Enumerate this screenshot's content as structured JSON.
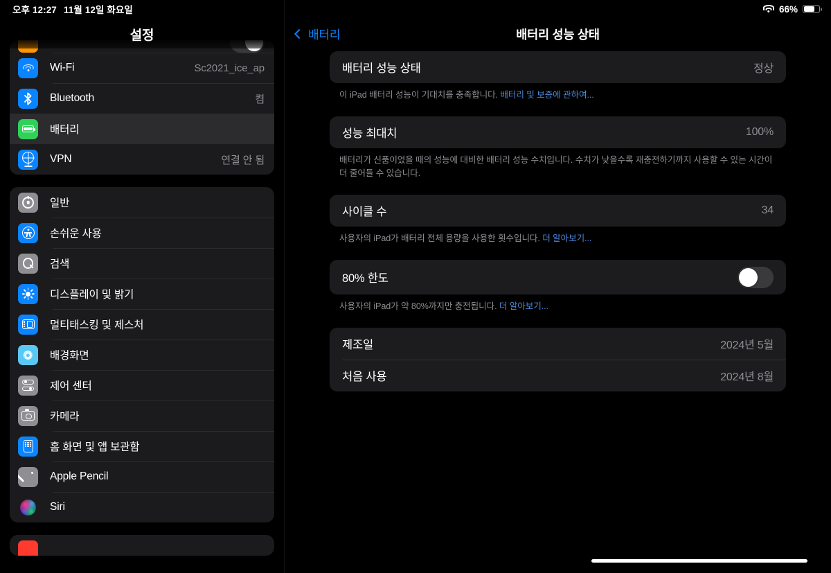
{
  "status_bar": {
    "time": "오후 12:27",
    "date": "11월 12일 화요일",
    "battery_percent": "66%",
    "wifi_icon": "wifi-icon",
    "battery_icon": "battery-icon"
  },
  "sidebar": {
    "title": "설정",
    "groups": [
      {
        "name": "connectivity",
        "items": [
          {
            "label": "",
            "value": "",
            "icon": "airplane-mode-icon",
            "partial": true,
            "toggle": true
          },
          {
            "label": "Wi-Fi",
            "value": "Sc2021_ice_ap",
            "icon": "wifi-icon"
          },
          {
            "label": "Bluetooth",
            "value": "켬",
            "icon": "bluetooth-icon"
          },
          {
            "label": "배터리",
            "value": "",
            "icon": "battery-icon",
            "selected": true
          },
          {
            "label": "VPN",
            "value": "연결 안 됨",
            "icon": "vpn-globe-icon"
          }
        ]
      },
      {
        "name": "system",
        "items": [
          {
            "label": "일반",
            "value": "",
            "icon": "gear-icon"
          },
          {
            "label": "손쉬운 사용",
            "value": "",
            "icon": "accessibility-icon"
          },
          {
            "label": "검색",
            "value": "",
            "icon": "search-icon"
          },
          {
            "label": "디스플레이 및 밝기",
            "value": "",
            "icon": "brightness-sun-icon"
          },
          {
            "label": "멀티태스킹 및 제스처",
            "value": "",
            "icon": "multitasking-icon"
          },
          {
            "label": "배경화면",
            "value": "",
            "icon": "wallpaper-flower-icon"
          },
          {
            "label": "제어 센터",
            "value": "",
            "icon": "control-center-icon"
          },
          {
            "label": "카메라",
            "value": "",
            "icon": "camera-icon"
          },
          {
            "label": "홈 화면 및 앱 보관함",
            "value": "",
            "icon": "home-screen-icon"
          },
          {
            "label": "Apple Pencil",
            "value": "",
            "icon": "pencil-icon"
          },
          {
            "label": "Siri",
            "value": "",
            "icon": "siri-orb-icon"
          }
        ]
      }
    ]
  },
  "detail": {
    "back_label": "배터리",
    "title": "배터리 성능 상태",
    "sections": [
      {
        "key": "health",
        "rows": [
          {
            "label": "배터리 성능 상태",
            "value": "정상"
          }
        ],
        "footnote_before": "이 iPad 배터리 성능이 기대치를 충족합니다. ",
        "footnote_link": "배터리 및 보증에 관하여...",
        "footnote_after": ""
      },
      {
        "key": "max_capacity",
        "rows": [
          {
            "label": "성능 최대치",
            "value": "100%"
          }
        ],
        "footnote_before": "배터리가 신품이었을 때의 성능에 대비한 배터리 성능 수치입니다. 수치가 낮을수록 재충전하기까지 사용할 수 있는 시간이 더 줄어들 수 있습니다.",
        "footnote_link": "",
        "footnote_after": ""
      },
      {
        "key": "cycle_count",
        "rows": [
          {
            "label": "사이클 수",
            "value": "34"
          }
        ],
        "footnote_before": "사용자의 iPad가 배터리 전체 용량을 사용한 횟수입니다. ",
        "footnote_link": "더 알아보기...",
        "footnote_after": ""
      },
      {
        "key": "limit_80",
        "rows": [
          {
            "label": "80% 한도",
            "value": "",
            "toggle": true,
            "toggle_on": false
          }
        ],
        "footnote_before": "사용자의 iPad가 약 80%까지만 충전됩니다. ",
        "footnote_link": "더 알아보기...",
        "footnote_after": ""
      },
      {
        "key": "dates",
        "rows": [
          {
            "label": "제조일",
            "value": "2024년 5월"
          },
          {
            "label": "처음 사용",
            "value": "2024년 8월"
          }
        ],
        "footnote_before": "",
        "footnote_link": "",
        "footnote_after": ""
      }
    ]
  },
  "colors": {
    "accent_blue": "#0a84ff",
    "link_blue": "#4a86d8",
    "card_bg": "#1c1c1e",
    "selected_row": "#2c2c2e",
    "secondary_text": "#8e8e93",
    "battery_green": "#30d158"
  }
}
